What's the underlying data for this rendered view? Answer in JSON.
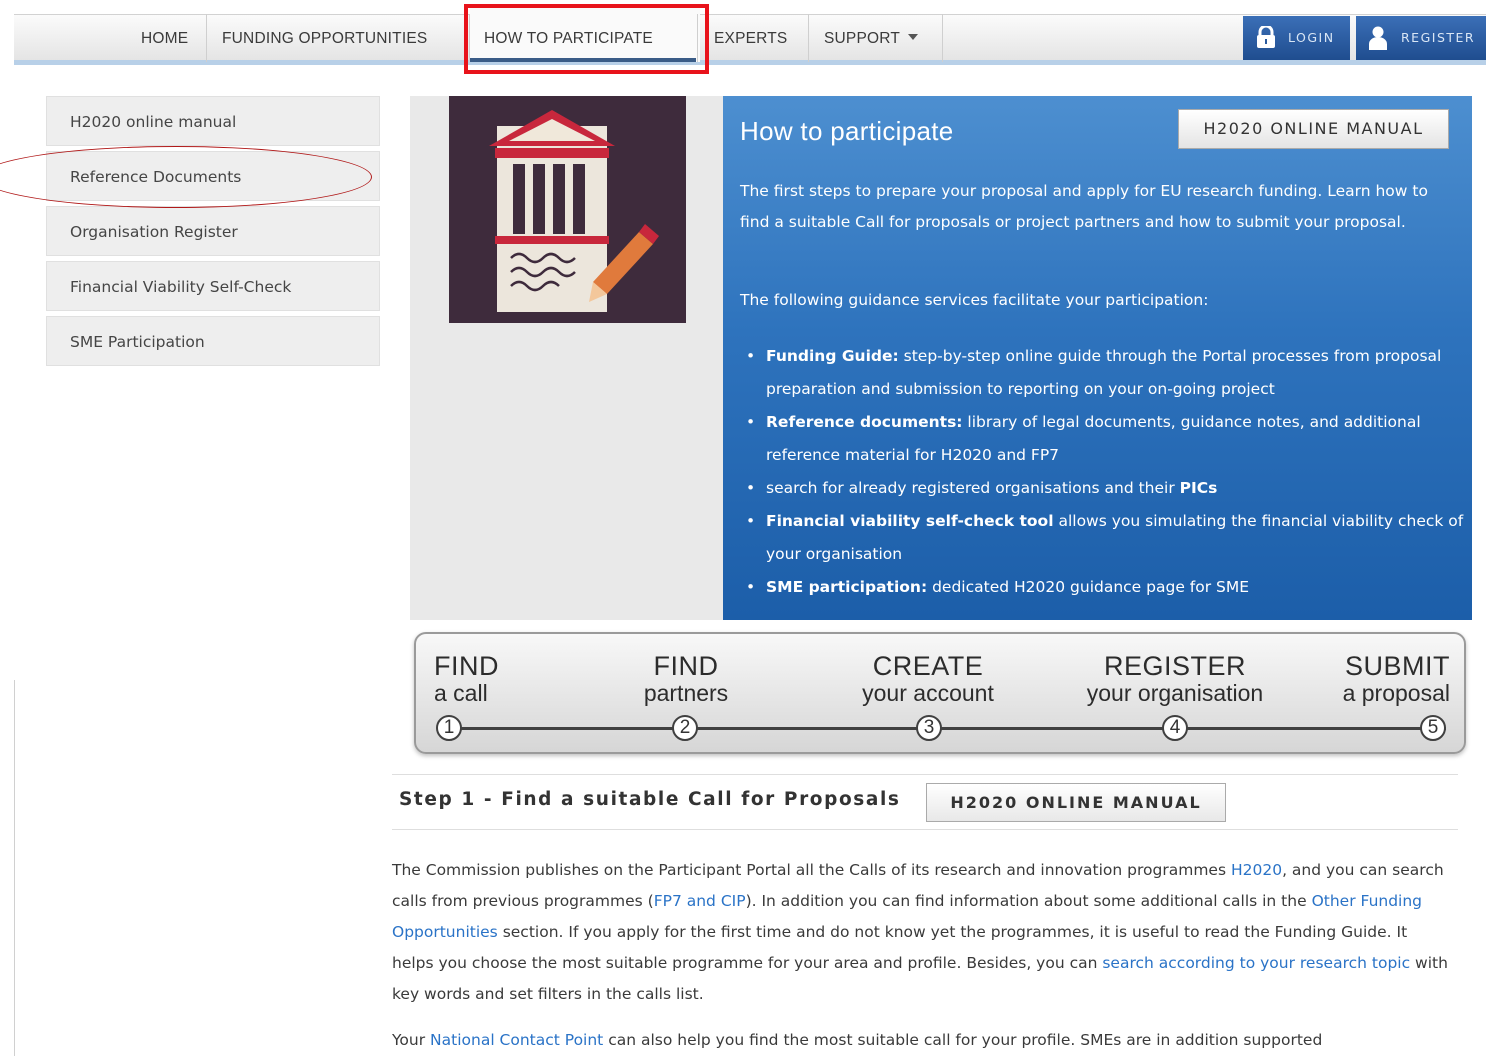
{
  "nav": {
    "items": [
      "HOME",
      "FUNDING OPPORTUNITIES",
      "HOW TO PARTICIPATE",
      "EXPERTS",
      "SUPPORT"
    ],
    "login": "LOGIN",
    "register": "REGISTER"
  },
  "sidebar": {
    "items": [
      {
        "label": "H2020 online manual"
      },
      {
        "label": "Reference Documents"
      },
      {
        "label": "Organisation Register"
      },
      {
        "label": "Financial Viability Self-Check"
      },
      {
        "label": "SME Participation"
      }
    ]
  },
  "hero": {
    "title": "How to participate",
    "manual_button": "H2020 ONLINE MANUAL",
    "intro": "The first steps to prepare your proposal and apply for EU research funding. Learn how to find a suitable Call for proposals or project partners and how to submit your proposal.",
    "guidance_intro": "The following guidance services facilitate your participation:",
    "list": [
      {
        "bold": "Funding Guide:",
        "text": " step-by-step online guide through the Portal processes from proposal preparation and submission to reporting on your on-going project"
      },
      {
        "bold": "Reference documents:",
        "text": " library of legal documents, guidance notes, and additional reference material for H2020 and FP7"
      },
      {
        "pre": "search for already registered organisations and their ",
        "bold": "PICs"
      },
      {
        "bold": "Financial viability self-check tool",
        "text": " allows you simulating the financial viability check of your organisation"
      },
      {
        "bold": "SME participation:",
        "text": " dedicated H2020 guidance page for SME"
      }
    ]
  },
  "steps": [
    {
      "big": "FIND",
      "small": "a call",
      "num": "1"
    },
    {
      "big": "FIND",
      "small": "partners",
      "num": "2"
    },
    {
      "big": "CREATE",
      "small": "your account",
      "num": "3"
    },
    {
      "big": "REGISTER",
      "small": "your organisation",
      "num": "4"
    },
    {
      "big": "SUBMIT",
      "small": "a proposal",
      "num": "5"
    }
  ],
  "step1": {
    "title": "Step 1 - Find a suitable Call for Proposals",
    "manual_button": "H2020 ONLINE MANUAL",
    "p1": {
      "t1": "The Commission publishes on the Participant Portal all the Calls of its research and innovation programmes ",
      "l1": "H2020",
      "t2": ", and you can search calls from previous programmes (",
      "l2": "FP7 and CIP",
      "t3": "). In addition you can find information about some additional calls in the ",
      "l3": "Other Funding Opportunities",
      "t4": " section. If you apply for the first time and do not know yet the programmes, it is useful to read the Funding Guide. It helps you choose the most suitable programme for your area and profile. Besides, you can ",
      "l4": "search according to your research topic",
      "t5": " with key words and set filters in the calls list."
    },
    "p2": {
      "t1": "Your ",
      "l1": "National Contact Point",
      "t2": " can also help you find the most suitable call for your profile. SMEs are in addition supported"
    }
  }
}
